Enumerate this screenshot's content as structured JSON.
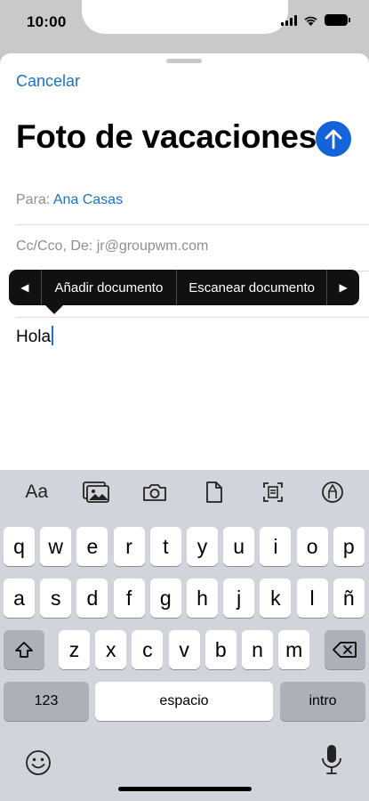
{
  "status_bar": {
    "time": "10:00"
  },
  "compose": {
    "cancel_label": "Cancelar",
    "subject_title": "Foto de vacaciones",
    "to_label": "Para:",
    "to_value": "Ana Casas",
    "cc_label": "Cc/Cco, De:",
    "from_value": "jr@groupwm.com",
    "body_text": "Hola"
  },
  "edit_menu": {
    "prev_glyph": "◀",
    "items": [
      "Añadir documento",
      "Escanear documento"
    ],
    "next_glyph": "▶"
  },
  "keyboard": {
    "toolbar": {
      "format_label": "Aa",
      "icons": [
        "photo-library-icon",
        "camera-icon",
        "document-icon",
        "scan-document-icon",
        "markup-icon"
      ]
    },
    "row1": [
      "q",
      "w",
      "e",
      "r",
      "t",
      "y",
      "u",
      "i",
      "o",
      "p"
    ],
    "row2": [
      "a",
      "s",
      "d",
      "f",
      "g",
      "h",
      "j",
      "k",
      "l",
      "ñ"
    ],
    "row3": [
      "z",
      "x",
      "c",
      "v",
      "b",
      "n",
      "m"
    ],
    "numbers_label": "123",
    "space_label": "espacio",
    "return_label": "intro"
  },
  "colors": {
    "accent": "#1a73c9",
    "send_button": "#1463d9",
    "keyboard_bg": "#d1d4da",
    "key_dark": "#abb0b9",
    "menu_bg": "#111111"
  }
}
